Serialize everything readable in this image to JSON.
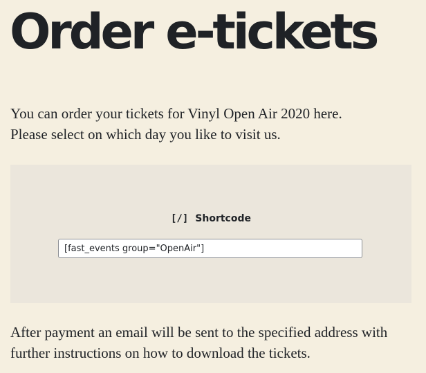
{
  "page": {
    "title": "Order e-tickets"
  },
  "intro": {
    "line1": "You can order your tickets for Vinyl Open Air 2020 here.",
    "line2": "Please select on which day you like to visit us."
  },
  "shortcode_block": {
    "icon": "shortcode-icon",
    "icon_glyph": "[/]",
    "label": "Shortcode",
    "value": "[fast_events group=\"OpenAir\"]"
  },
  "after": {
    "line1": "After payment an email will be sent to the specified address with",
    "line2": "further instructions on how to download the tickets."
  },
  "colors": {
    "background": "#f5efe0",
    "block_background": "#ebe6dc",
    "text": "#1f2226"
  }
}
